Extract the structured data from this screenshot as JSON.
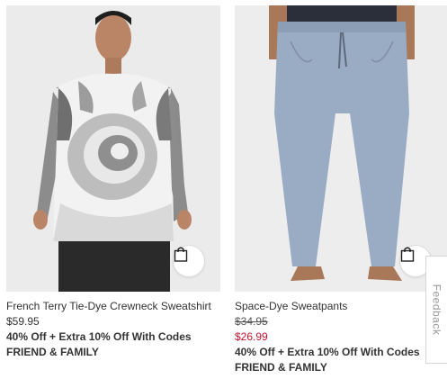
{
  "products": [
    {
      "name": "French Terry Tie-Dye Crewneck Sweatshirt",
      "price": "$59.95",
      "promo": "40% Off + Extra 10% Off With Codes",
      "code": "FRIEND & FAMILY",
      "image_icon": "product-photo-sweatshirt",
      "bag_icon": "shopping-bag-icon"
    },
    {
      "name": "Space-Dye Sweatpants",
      "original_price": "$34.95",
      "sale_price": "$26.99",
      "promo": "40% Off + Extra 10% Off With Codes",
      "code": "FRIEND & FAMILY",
      "image_icon": "product-photo-sweatpants",
      "bag_icon": "shopping-bag-icon"
    }
  ],
  "feedback": {
    "label": "Feedback"
  },
  "colors": {
    "sale_price": "#c8102e",
    "text": "#333333",
    "photo_background": "#ececec"
  }
}
